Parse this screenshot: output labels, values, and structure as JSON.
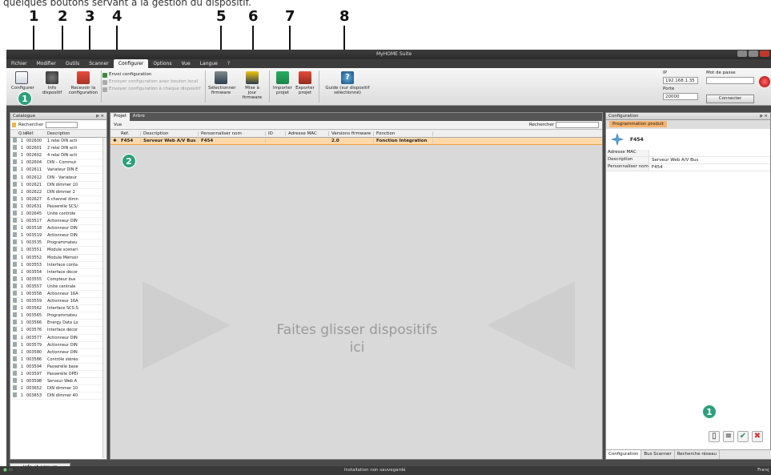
{
  "caption": "quelques boutons servant à la gestion du dispositif.",
  "callouts": [
    "1",
    "2",
    "3",
    "4",
    "5",
    "6",
    "7",
    "8"
  ],
  "window": {
    "title": "MyHOME Suite"
  },
  "menu": [
    "Fichier",
    "Modifier",
    "Outils",
    "Scanner",
    "Configurer",
    "Options",
    "Vue",
    "Langue",
    "?"
  ],
  "menu_active": "Configurer",
  "ribbon": {
    "configurer": "Configurer",
    "info": "Info dispositif",
    "recevoir": "Recevoir la configuration",
    "envoi": "Envoi configuration",
    "envoi_bouton": "Envoyer configuration avec bouton local",
    "envoi_chaque": "Envoyer configuration à chaque dispositif",
    "selectionner": "Sélectionner firmware",
    "maj": "Mise à jour firmware",
    "importer": "Importer projet",
    "exporter": "Exporter projet",
    "guide": "Guide (sur dispositif sélectionné)"
  },
  "connection": {
    "ip_label": "IP",
    "ip_value": "192.168.1.35",
    "port_label": "Porte",
    "port_value": "20000",
    "password_label": "Mot de passe",
    "connect_label": "Connecter"
  },
  "catalog": {
    "title": "Catalogue",
    "search_label": "Rechercher",
    "headers": {
      "qty": "Q.té",
      "ref": "Réf.",
      "desc": "Description"
    },
    "rows": [
      [
        "1",
        "002600",
        "1 relai DIN acti"
      ],
      [
        "1",
        "002601",
        "2 relai DIN acti"
      ],
      [
        "1",
        "002602",
        "4 relai DIN acti"
      ],
      [
        "1",
        "002604",
        "DIN – Commut"
      ],
      [
        "1",
        "002611",
        "Variateur DIN E"
      ],
      [
        "1",
        "002612",
        "DIN - Variateur"
      ],
      [
        "1",
        "002621",
        "DIN dimmer 10"
      ],
      [
        "1",
        "002622",
        "DIN dimmer 2"
      ],
      [
        "1",
        "002627",
        "6 channel dimn"
      ],
      [
        "1",
        "002631",
        "Passerelle SCS/"
      ],
      [
        "1",
        "002645",
        "Unité contrôle"
      ],
      [
        "1",
        "003517",
        "Actionneur DIN"
      ],
      [
        "1",
        "003518",
        "Actionneur DIN"
      ],
      [
        "1",
        "003519",
        "Actionneur DIN"
      ],
      [
        "1",
        "003535",
        "Programmateu"
      ],
      [
        "1",
        "003551",
        "Module scénari"
      ],
      [
        "1",
        "003552",
        "Module Mémoir"
      ],
      [
        "1",
        "003553",
        "Interface conta"
      ],
      [
        "1",
        "003554",
        "Interface décor"
      ],
      [
        "1",
        "003555",
        "Compteur bus"
      ],
      [
        "1",
        "003557",
        "Unité centrale"
      ],
      [
        "1",
        "003558",
        "Actionneur 16A"
      ],
      [
        "1",
        "003559",
        "Actionneur 16A"
      ],
      [
        "1",
        "003562",
        "Interface SCS-S"
      ],
      [
        "1",
        "003565",
        "Programmateu"
      ],
      [
        "1",
        "003566",
        "Energy Data Lo"
      ],
      [
        "1",
        "003576",
        "Interface décor"
      ],
      [
        "1",
        "003577",
        "Actionneur DIN"
      ],
      [
        "1",
        "003579",
        "Actionneur DIN"
      ],
      [
        "1",
        "003580",
        "Actionneur DIN"
      ],
      [
        "1",
        "003586",
        "Contrôle stéréo"
      ],
      [
        "1",
        "003594",
        "Passerelle base"
      ],
      [
        "1",
        "003597",
        "Passerelle OPEI"
      ],
      [
        "1",
        "003598",
        "Serveur Web A"
      ],
      [
        "1",
        "003652",
        "DIN dimmer 10"
      ],
      [
        "1",
        "003653",
        "DIN dimmer 40"
      ]
    ]
  },
  "center": {
    "tabs": [
      "Projet",
      "Arbre"
    ],
    "vue_label": "Vue",
    "search_label": "Rechercher",
    "headers": [
      "Réf.",
      "Description",
      "Personnaliser nom",
      "ID",
      "Adresse MAC",
      "Versions firmware",
      "Fonction"
    ],
    "row": [
      "F454",
      "Serveur Web A/V Bus",
      "F454",
      "",
      "",
      "2.0",
      "Fonction Intégration"
    ],
    "drop_line1": "Faites glisser dispositifs",
    "drop_line2": "ici"
  },
  "config": {
    "title": "Configuration",
    "tab": "Programmation produit",
    "device": "F454",
    "props": [
      [
        "Adresse MAC",
        ""
      ],
      [
        "Description",
        "Serveur Web A/V Bus"
      ],
      [
        "Personnaliser nom",
        "F454"
      ]
    ],
    "bottom_tabs": [
      "Configuration",
      "Bus Scanner",
      "Recherche réseau"
    ]
  },
  "info_label": "Info et erreurs",
  "status": {
    "text": "Installation non sauvegardé",
    "lang": "Franç"
  },
  "badges": [
    "1",
    "2",
    "1"
  ]
}
